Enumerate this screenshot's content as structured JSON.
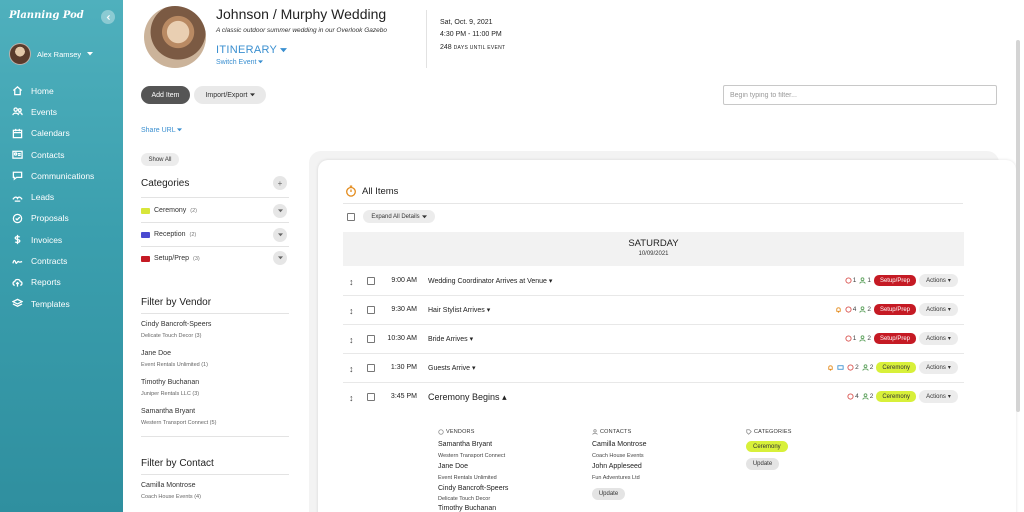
{
  "app": {
    "brand": "Planning Pod"
  },
  "user": {
    "name": "Alex Ramsey"
  },
  "nav": [
    {
      "label": "Home",
      "icon": "home-icon"
    },
    {
      "label": "Events",
      "icon": "people-icon"
    },
    {
      "label": "Calendars",
      "icon": "calendar-icon"
    },
    {
      "label": "Contacts",
      "icon": "contact-card-icon"
    },
    {
      "label": "Communications",
      "icon": "chat-icon"
    },
    {
      "label": "Leads",
      "icon": "lead-icon"
    },
    {
      "label": "Proposals",
      "icon": "proposal-icon"
    },
    {
      "label": "Invoices",
      "icon": "dollar-icon"
    },
    {
      "label": "Contracts",
      "icon": "signature-icon"
    },
    {
      "label": "Reports",
      "icon": "upload-icon"
    },
    {
      "label": "Templates",
      "icon": "stack-icon"
    }
  ],
  "event": {
    "title": "Johnson / Murphy Wedding",
    "subtitle": "A classic outdoor summer wedding in our Overlook Gazebo",
    "section": "ITINERARY",
    "switch": "Switch Event",
    "date": "Sat, Oct. 9, 2021",
    "time": "4:30 PM - 11:00 PM",
    "days_num": "248",
    "days_label": "DAYS UNTIL EVENT"
  },
  "toolbar": {
    "add_item": "Add Item",
    "import_export": "Import/Export",
    "filter_placeholder": "Begin typing to filter...",
    "share_url": "Share URL",
    "show_all": "Show All"
  },
  "categories": {
    "title": "Categories",
    "items": [
      {
        "label": "Ceremony",
        "count": "(2)",
        "color": "#d8e63a"
      },
      {
        "label": "Reception",
        "count": "(2)",
        "color": "#4a4ad0"
      },
      {
        "label": "Setup/Prep",
        "count": "(3)",
        "color": "#c51a24"
      }
    ]
  },
  "vendors": {
    "title": "Filter by Vendor",
    "items": [
      {
        "name": "Cindy Bancroft-Speers",
        "company": "Delicate Touch Decor (3)"
      },
      {
        "name": "Jane Doe",
        "company": "Event Rentals Unlimited (1)"
      },
      {
        "name": "Timothy Buchanan",
        "company": "Juniper Rentals LLC (3)"
      },
      {
        "name": "Samantha Bryant",
        "company": "Western Transport Connect (5)"
      }
    ]
  },
  "contacts_filter": {
    "title": "Filter by Contact",
    "items": [
      {
        "name": "Camilla Montrose",
        "company": "Coach House Events (4)"
      }
    ]
  },
  "main": {
    "title": "All Items",
    "expand": "Expand All Details",
    "day": "SATURDAY",
    "day_date": "10/09/2021",
    "rows": [
      {
        "time": "9:00 AM",
        "title": "Wedding Coordinator Arrives at Venue",
        "vendors": "1",
        "contacts": "1",
        "badge": "Setup/Prep",
        "actions": "Actions"
      },
      {
        "time": "9:30 AM",
        "title": "Hair Stylist Arrives",
        "vendors": "4",
        "contacts": "2",
        "badge": "Setup/Prep",
        "actions": "Actions"
      },
      {
        "time": "10:30 AM",
        "title": "Bride Arrives",
        "vendors": "1",
        "contacts": "2",
        "badge": "Setup/Prep",
        "actions": "Actions"
      },
      {
        "time": "1:30 PM",
        "title": "Guests Arrive",
        "vendors": "2",
        "contacts": "2",
        "badge": "Ceremony",
        "actions": "Actions"
      },
      {
        "time": "3:45 PM",
        "title": "Ceremony Begins",
        "vendors": "4",
        "contacts": "2",
        "badge": "Ceremony",
        "actions": "Actions"
      }
    ],
    "detail": {
      "vendors_h": "VENDORS",
      "vendors": [
        {
          "name": "Samantha Bryant",
          "company": "Western Transport Connect"
        },
        {
          "name": "Jane Doe",
          "company": "Event Rentals Unlimited"
        },
        {
          "name": "Cindy Bancroft-Speers",
          "company": "Delicate Touch Decor"
        },
        {
          "name": "Timothy Buchanan"
        }
      ],
      "contacts_h": "CONTACTS",
      "contacts": [
        {
          "name": "Camilla Montrose",
          "company": "Coach House Events"
        },
        {
          "name": "John Appleseed",
          "company": "Fun Adventures Ltd"
        }
      ],
      "categories_h": "CATEGORIES",
      "category": "Ceremony",
      "update": "Update"
    }
  }
}
